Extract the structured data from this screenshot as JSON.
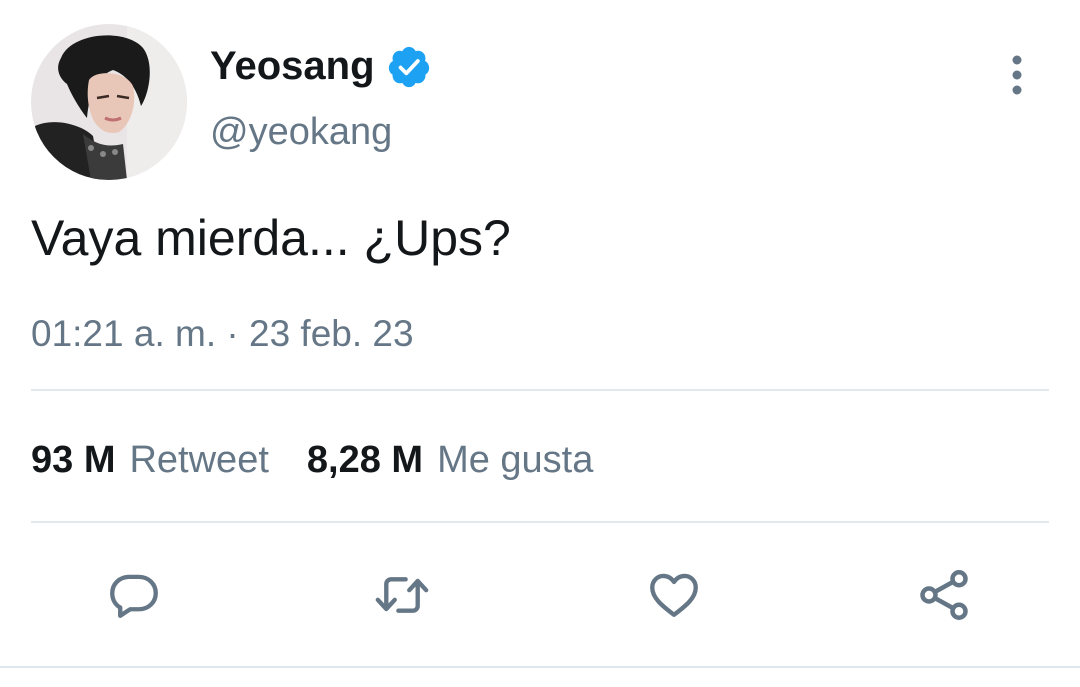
{
  "tweet": {
    "author": {
      "display_name": "Yeosang",
      "handle": "@yeokang",
      "verified": true
    },
    "text": "Vaya mierda... ¿Ups?",
    "timestamp": "01:21 a. m. · 23 feb. 23",
    "stats": {
      "retweets": {
        "count": "93 M",
        "label": "Retweet"
      },
      "likes": {
        "count": "8,28 M",
        "label": "Me gusta"
      }
    },
    "actions": [
      {
        "name": "reply",
        "icon": "comment-icon"
      },
      {
        "name": "retweet",
        "icon": "retweet-icon"
      },
      {
        "name": "like",
        "icon": "heart-icon"
      },
      {
        "name": "share",
        "icon": "share-icon"
      }
    ]
  },
  "colors": {
    "verified_blue": "#1da1f2",
    "text_primary": "#14171a",
    "text_secondary": "#657786",
    "divider": "#e1e8ed"
  }
}
